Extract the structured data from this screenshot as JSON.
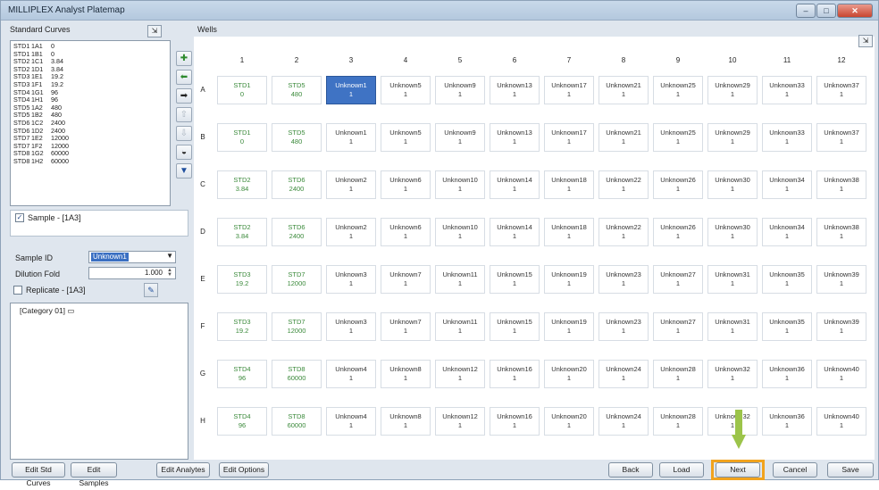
{
  "title": "MILLIPLEX Analyst Platemap",
  "window_controls": {
    "minimize": "–",
    "maximize": "□",
    "close": "✕"
  },
  "standards": {
    "label": "Standard Curves",
    "rows": [
      [
        "STD1",
        "1A1",
        "0"
      ],
      [
        "STD1",
        "1B1",
        "0"
      ],
      [
        "STD2",
        "1C1",
        "3.84"
      ],
      [
        "STD2",
        "1D1",
        "3.84"
      ],
      [
        "STD3",
        "1E1",
        "19.2"
      ],
      [
        "STD3",
        "1F1",
        "19.2"
      ],
      [
        "STD4",
        "1G1",
        "96"
      ],
      [
        "STD4",
        "1H1",
        "96"
      ],
      [
        "STD5",
        "1A2",
        "480"
      ],
      [
        "STD5",
        "1B2",
        "480"
      ],
      [
        "STD6",
        "1C2",
        "2400"
      ],
      [
        "STD6",
        "1D2",
        "2400"
      ],
      [
        "STD7",
        "1E2",
        "12000"
      ],
      [
        "STD7",
        "1F2",
        "12000"
      ],
      [
        "STD8",
        "1G2",
        "60000"
      ],
      [
        "STD8",
        "1H2",
        "60000"
      ]
    ]
  },
  "sample": {
    "header": "Sample - [1A3]",
    "sample_id_label": "Sample ID",
    "sample_id_value": "Unknown1",
    "dilution_label": "Dilution Fold",
    "dilution_value": "1.000",
    "replicate_label": "Replicate - [1A3]",
    "category": "[Category 01]"
  },
  "wells": {
    "label": "Wells",
    "columns": [
      "1",
      "2",
      "3",
      "4",
      "5",
      "6",
      "7",
      "8",
      "9",
      "10",
      "11",
      "12"
    ],
    "rows": [
      "A",
      "B",
      "C",
      "D",
      "E",
      "F",
      "G",
      "H"
    ],
    "col1": [
      [
        "STD1",
        "0"
      ],
      [
        "STD1",
        "0"
      ],
      [
        "STD2",
        "3.84"
      ],
      [
        "STD2",
        "3.84"
      ],
      [
        "STD3",
        "19.2"
      ],
      [
        "STD3",
        "19.2"
      ],
      [
        "STD4",
        "96"
      ],
      [
        "STD4",
        "96"
      ]
    ],
    "col2": [
      [
        "STD5",
        "480"
      ],
      [
        "STD5",
        "480"
      ],
      [
        "STD6",
        "2400"
      ],
      [
        "STD6",
        "2400"
      ],
      [
        "STD7",
        "12000"
      ],
      [
        "STD7",
        "12000"
      ],
      [
        "STD8",
        "60000"
      ],
      [
        "STD8",
        "60000"
      ]
    ],
    "unknown_prefix": "Unknown",
    "unknown_dilution": "1",
    "selected_well": "A3"
  },
  "buttons": {
    "edit_std": "Edit Std Curves",
    "edit_samples": "Edit Samples",
    "edit_analytes": "Edit Analytes",
    "edit_options": "Edit Options",
    "back": "Back",
    "load": "Load",
    "next": "Next",
    "cancel": "Cancel",
    "save": "Save"
  },
  "colors": {
    "highlight": "#f1a31e",
    "arrow": "#9cc44a",
    "selected": "#3f73c4",
    "standard_text": "#3b8a3b"
  }
}
